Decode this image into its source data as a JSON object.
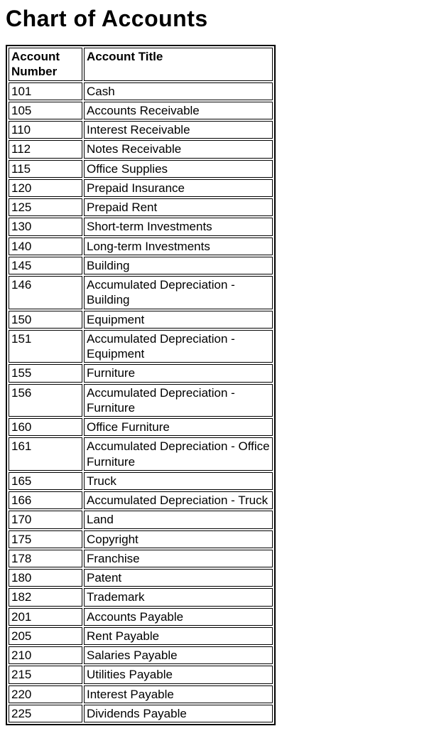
{
  "heading": "Chart of Accounts",
  "table": {
    "headers": {
      "number": "Account Number",
      "title": "Account Title"
    },
    "rows": [
      {
        "number": "101",
        "title": "Cash"
      },
      {
        "number": "105",
        "title": "Accounts Receivable"
      },
      {
        "number": "110",
        "title": "Interest Receivable"
      },
      {
        "number": "112",
        "title": "Notes Receivable"
      },
      {
        "number": "115",
        "title": "Office Supplies"
      },
      {
        "number": "120",
        "title": "Prepaid Insurance"
      },
      {
        "number": "125",
        "title": "Prepaid Rent"
      },
      {
        "number": "130",
        "title": "Short-term Investments"
      },
      {
        "number": "140",
        "title": "Long-term Investments"
      },
      {
        "number": "145",
        "title": "Building"
      },
      {
        "number": "146",
        "title": "Accumulated Depreciation - Building"
      },
      {
        "number": "150",
        "title": "Equipment"
      },
      {
        "number": "151",
        "title": "Accumulated Depreciation - Equipment"
      },
      {
        "number": "155",
        "title": "Furniture"
      },
      {
        "number": "156",
        "title": "Accumulated Depreciation - Furniture"
      },
      {
        "number": "160",
        "title": "Office Furniture"
      },
      {
        "number": "161",
        "title": "Accumulated Depreciation - Office Furniture"
      },
      {
        "number": "165",
        "title": "Truck"
      },
      {
        "number": "166",
        "title": "Accumulated Depreciation - Truck"
      },
      {
        "number": "170",
        "title": "Land"
      },
      {
        "number": "175",
        "title": "Copyright"
      },
      {
        "number": "178",
        "title": "Franchise"
      },
      {
        "number": "180",
        "title": "Patent"
      },
      {
        "number": "182",
        "title": "Trademark"
      },
      {
        "number": "201",
        "title": "Accounts Payable"
      },
      {
        "number": "205",
        "title": "Rent Payable"
      },
      {
        "number": "210",
        "title": "Salaries Payable"
      },
      {
        "number": "215",
        "title": "Utilities Payable"
      },
      {
        "number": "220",
        "title": "Interest Payable"
      },
      {
        "number": "225",
        "title": "Dividends Payable"
      }
    ]
  },
  "chart_data": {
    "type": "table",
    "title": "Chart of Accounts",
    "columns": [
      "Account Number",
      "Account Title"
    ],
    "rows": [
      [
        "101",
        "Cash"
      ],
      [
        "105",
        "Accounts Receivable"
      ],
      [
        "110",
        "Interest Receivable"
      ],
      [
        "112",
        "Notes Receivable"
      ],
      [
        "115",
        "Office Supplies"
      ],
      [
        "120",
        "Prepaid Insurance"
      ],
      [
        "125",
        "Prepaid Rent"
      ],
      [
        "130",
        "Short-term Investments"
      ],
      [
        "140",
        "Long-term Investments"
      ],
      [
        "145",
        "Building"
      ],
      [
        "146",
        "Accumulated Depreciation - Building"
      ],
      [
        "150",
        "Equipment"
      ],
      [
        "151",
        "Accumulated Depreciation - Equipment"
      ],
      [
        "155",
        "Furniture"
      ],
      [
        "156",
        "Accumulated Depreciation - Furniture"
      ],
      [
        "160",
        "Office Furniture"
      ],
      [
        "161",
        "Accumulated Depreciation - Office Furniture"
      ],
      [
        "165",
        "Truck"
      ],
      [
        "166",
        "Accumulated Depreciation - Truck"
      ],
      [
        "170",
        "Land"
      ],
      [
        "175",
        "Copyright"
      ],
      [
        "178",
        "Franchise"
      ],
      [
        "180",
        "Patent"
      ],
      [
        "182",
        "Trademark"
      ],
      [
        "201",
        "Accounts Payable"
      ],
      [
        "205",
        "Rent Payable"
      ],
      [
        "210",
        "Salaries Payable"
      ],
      [
        "215",
        "Utilities Payable"
      ],
      [
        "220",
        "Interest Payable"
      ],
      [
        "225",
        "Dividends Payable"
      ]
    ]
  }
}
